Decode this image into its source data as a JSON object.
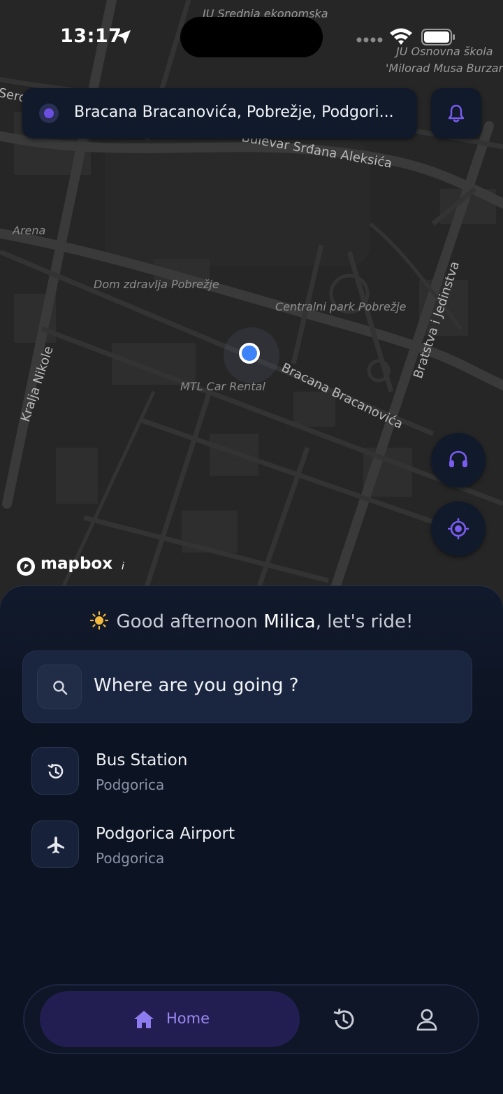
{
  "status_bar": {
    "time": "13:17"
  },
  "map": {
    "labels": {
      "poi_school_top": "JU Srednja ekonomska",
      "poi_school_right_1": "JU Osnovna škola",
      "poi_school_right_2": "'Milorad Musa Burzan",
      "road_partial_left": "Serd",
      "road_bulevar": "Bulevar Srđana Aleksića",
      "poi_arena": "Arena",
      "road_bratstva": "Bratstva i Jedinstva",
      "poi_dom_zdravlja": "Dom zdravlja Pobrežje",
      "poi_centralni_park": "Centralni park Pobrežje",
      "road_kralja_nikole": "Kralja Nikole",
      "road_bracana": "Bracana Bracanovića",
      "poi_mtl": "MTL Car Rental"
    },
    "attribution": "mapbox",
    "info_glyph": "i"
  },
  "address_bar": {
    "text": "Bracana Bracanovića, Pobrežje, Podgori..."
  },
  "sheet": {
    "greeting_prefix": "Good afternoon",
    "greeting_name": "Milica",
    "greeting_suffix": ", let's ride!",
    "search_placeholder": "Where are you going ?",
    "places": [
      {
        "title": "Bus Station",
        "subtitle": "Podgorica",
        "icon": "history-icon"
      },
      {
        "title": "Podgorica Airport",
        "subtitle": "Podgorica",
        "icon": "airplane-icon"
      }
    ]
  },
  "tabbar": {
    "home_label": "Home",
    "items": [
      "home-icon",
      "history-icon",
      "profile-icon"
    ]
  },
  "colors": {
    "accent": "#6a4fe0",
    "accent_text": "#9b89f2",
    "sheet_bg": "#0c1322",
    "map_bg": "#262626",
    "user_dot": "#3f83f8"
  }
}
